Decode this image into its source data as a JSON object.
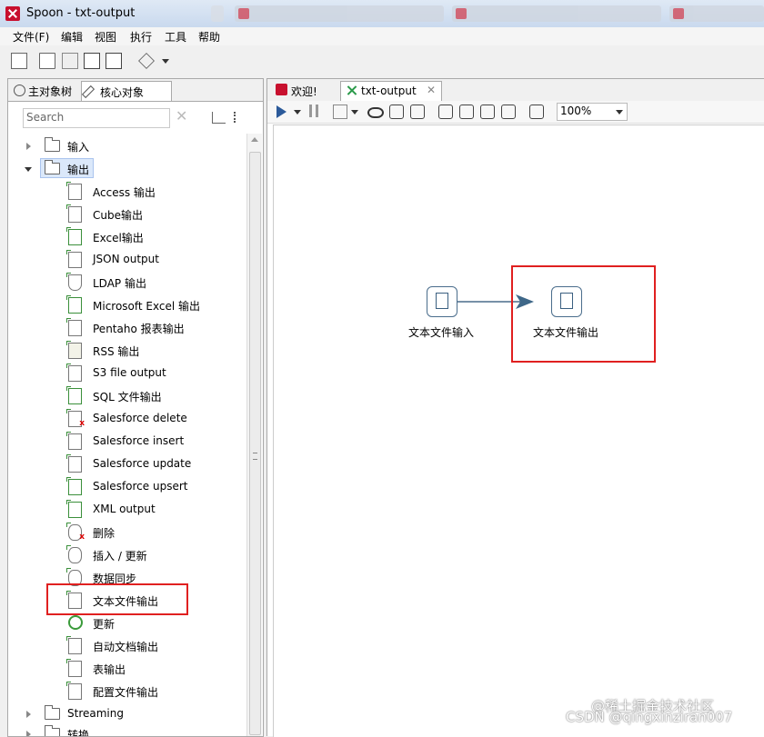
{
  "window": {
    "title": "Spoon - txt-output"
  },
  "menu": [
    "文件(F)",
    "编辑",
    "视图",
    "执行",
    "工具",
    "帮助"
  ],
  "left_panel": {
    "tabs": [
      {
        "label": "主对象树",
        "icon": "search-icon"
      },
      {
        "label": "核心对象",
        "icon": "pencil-icon"
      }
    ],
    "search_placeholder": "Search",
    "tree": [
      {
        "label": "输入",
        "type": "folder",
        "expanded": false
      },
      {
        "label": "输出",
        "type": "folder",
        "expanded": true,
        "selected": true
      },
      {
        "label": "Access 输出",
        "type": "step"
      },
      {
        "label": "Cube输出",
        "type": "step"
      },
      {
        "label": "Excel输出",
        "type": "step"
      },
      {
        "label": "JSON output",
        "type": "step"
      },
      {
        "label": "LDAP 输出",
        "type": "step"
      },
      {
        "label": "Microsoft Excel 输出",
        "type": "step"
      },
      {
        "label": "Pentaho 报表输出",
        "type": "step"
      },
      {
        "label": "RSS 输出",
        "type": "step"
      },
      {
        "label": "S3 file output",
        "type": "step"
      },
      {
        "label": "SQL 文件输出",
        "type": "step"
      },
      {
        "label": "Salesforce delete",
        "type": "step"
      },
      {
        "label": "Salesforce insert",
        "type": "step"
      },
      {
        "label": "Salesforce update",
        "type": "step"
      },
      {
        "label": "Salesforce upsert",
        "type": "step"
      },
      {
        "label": "XML output",
        "type": "step"
      },
      {
        "label": "删除",
        "type": "step"
      },
      {
        "label": "插入 / 更新",
        "type": "step"
      },
      {
        "label": "数据同步",
        "type": "step"
      },
      {
        "label": "文本文件输出",
        "type": "step",
        "highlighted": true
      },
      {
        "label": "更新",
        "type": "step"
      },
      {
        "label": "自动文档输出",
        "type": "step"
      },
      {
        "label": "表输出",
        "type": "step"
      },
      {
        "label": "配置文件输出",
        "type": "step"
      },
      {
        "label": "Streaming",
        "type": "folder",
        "expanded": false
      },
      {
        "label": "转换",
        "type": "folder",
        "expanded": false
      }
    ]
  },
  "editor": {
    "tabs": [
      {
        "label": "欢迎!",
        "active": false
      },
      {
        "label": "txt-output",
        "active": true
      }
    ],
    "zoom": "100%",
    "steps": [
      {
        "label": "文本文件输入"
      },
      {
        "label": "文本文件输出",
        "highlighted": true
      }
    ]
  },
  "watermark": "CSDN @qingxinziran007",
  "watermark2": "@稀土掘金技术社区",
  "colors": {
    "highlight_box": "#e02020",
    "hop_line": "#4a6d8c",
    "app_red": "#c8102e"
  }
}
